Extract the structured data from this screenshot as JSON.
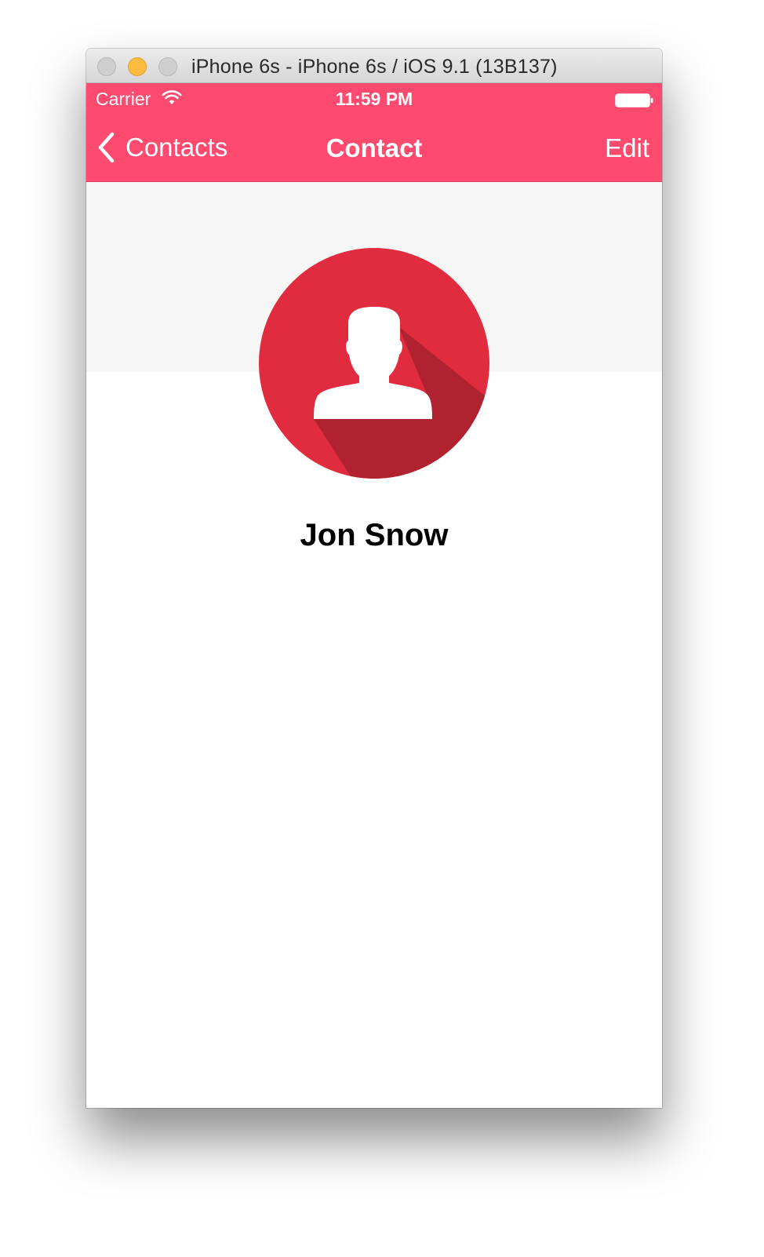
{
  "window": {
    "title": "iPhone 6s - iPhone 6s / iOS 9.1 (13B137)"
  },
  "status_bar": {
    "carrier": "Carrier",
    "time": "11:59 PM",
    "icons": [
      "wifi-icon",
      "battery-icon"
    ]
  },
  "nav_bar": {
    "back_label": "Contacts",
    "title": "Contact",
    "edit_label": "Edit"
  },
  "contact": {
    "name": "Jon Snow",
    "avatar_icon": "person-icon"
  },
  "colors": {
    "accent": "#fe4a6e",
    "avatar_red": "#e02c3e",
    "avatar_shadow": "#b0222f",
    "header_band": "#f6f6f6"
  }
}
